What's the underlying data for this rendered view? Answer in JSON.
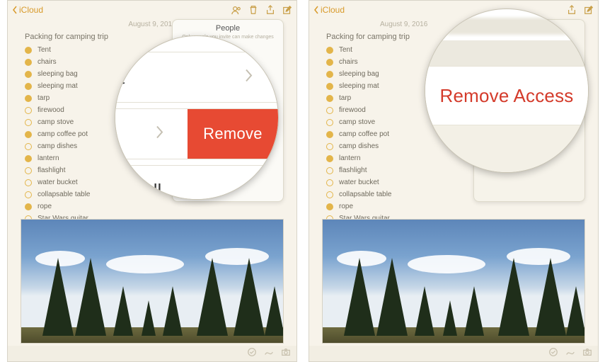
{
  "header": {
    "back_label": "iCloud",
    "date": "August 9, 2016"
  },
  "note": {
    "title": "Packing for camping trip",
    "items": [
      {
        "label": "Tent",
        "checked": true
      },
      {
        "label": "chairs",
        "checked": true
      },
      {
        "label": "sleeping bag",
        "checked": true
      },
      {
        "label": "sleeping mat",
        "checked": true
      },
      {
        "label": "tarp",
        "checked": true
      },
      {
        "label": "firewood",
        "checked": false
      },
      {
        "label": "camp stove",
        "checked": false
      },
      {
        "label": "camp coffee pot",
        "checked": true
      },
      {
        "label": "camp dishes",
        "checked": false
      },
      {
        "label": "lantern",
        "checked": true
      },
      {
        "label": "flashlight",
        "checked": false
      },
      {
        "label": "water bucket",
        "checked": false
      },
      {
        "label": "collapsable table",
        "checked": false
      },
      {
        "label": "rope",
        "checked": true
      },
      {
        "label": "Star Wars guitar",
        "checked": false
      }
    ]
  },
  "popover": {
    "title": "People",
    "subtitle": "Only people you invite can make changes"
  },
  "zoom_left": {
    "row1_fragment": "t",
    "remove_label": "Remove",
    "row3_fragment": "dwell"
  },
  "zoom_right": {
    "action_label": "Remove Access"
  }
}
